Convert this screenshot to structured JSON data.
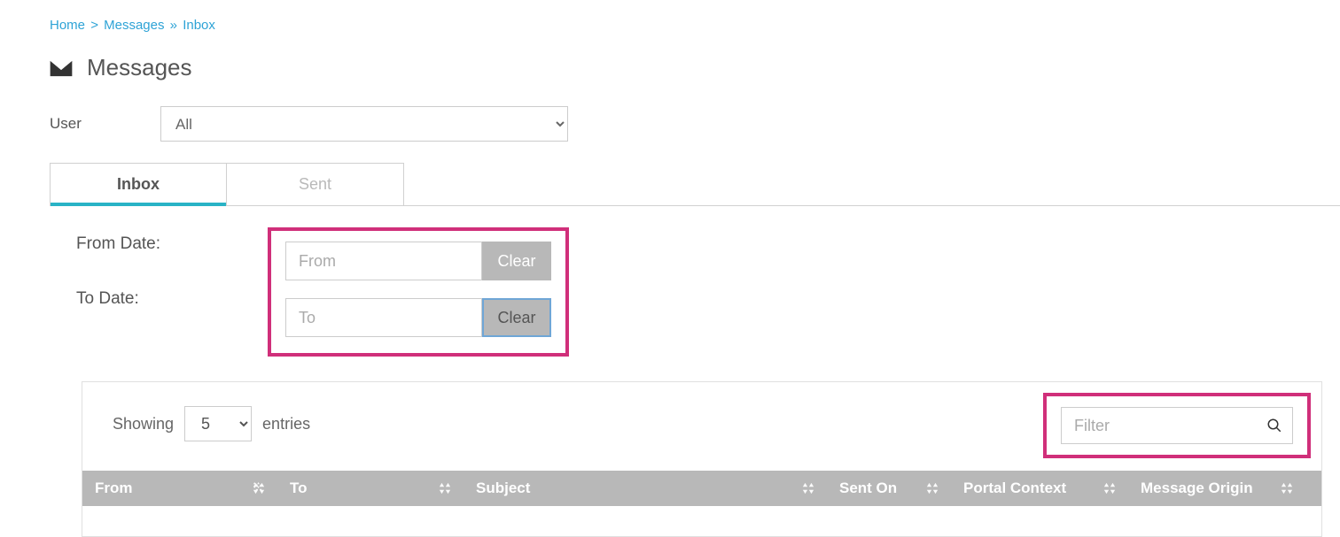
{
  "breadcrumb": {
    "items": [
      {
        "label": "Home"
      },
      {
        "label": "Messages"
      },
      {
        "label": "Inbox"
      }
    ],
    "sep1": ">",
    "sep2": "»"
  },
  "page_title": "Messages",
  "user_filter": {
    "label": "User",
    "selected": "All"
  },
  "tabs": {
    "inbox": "Inbox",
    "sent": "Sent"
  },
  "date_filter": {
    "from_label": "From Date:",
    "to_label": "To Date:",
    "from_placeholder": "From",
    "to_placeholder": "To",
    "clear_label": "Clear"
  },
  "table_controls": {
    "showing_prefix": "Showing",
    "showing_suffix": "entries",
    "page_size": "5",
    "filter_placeholder": "Filter"
  },
  "columns": {
    "from": "From",
    "to": "To",
    "subject": "Subject",
    "sent_on": "Sent On",
    "portal_context": "Portal Context",
    "message_origin": "Message Origin"
  }
}
